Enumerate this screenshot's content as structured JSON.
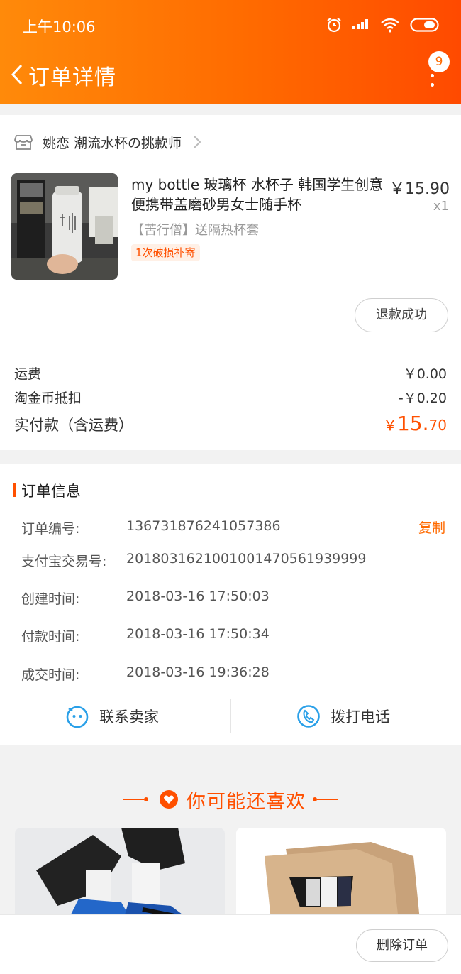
{
  "status_bar": {
    "time": "上午10:06"
  },
  "header": {
    "title": "订单详情",
    "message_count": "9"
  },
  "shop": {
    "name": "姚恋 潮流水杯の挑款师"
  },
  "product": {
    "title": "my bottle 玻璃杯 水杯子 韩国学生创意便携带盖磨砂男女士随手杯",
    "price": "￥15.90",
    "quantity": "x1",
    "sku": "【苦行僧】送隔热杯套",
    "tag": "1次破损补寄",
    "refund_status": "退款成功"
  },
  "fees": {
    "shipping_label": "运费",
    "shipping_value": "￥0.00",
    "coin_label": "淘金币抵扣",
    "coin_value": "-￥0.20",
    "total_label": "实付款（含运费）",
    "total_currency": "￥",
    "total_int": "15.",
    "total_dec": "70"
  },
  "order_info": {
    "title": "订单信息",
    "copy_label": "复制",
    "rows": [
      {
        "label": "订单编号:",
        "value": "136731876241057386"
      },
      {
        "label": "支付宝交易号:",
        "value": "2018031621001001470561939999"
      },
      {
        "label": "创建时间:",
        "value": "2018-03-16 17:50:03"
      },
      {
        "label": "付款时间:",
        "value": "2018-03-16 17:50:34"
      },
      {
        "label": "成交时间:",
        "value": "2018-03-16 19:36:28"
      }
    ]
  },
  "contact": {
    "seller_label": "联系卖家",
    "phone_label": "拨打电话"
  },
  "recommend": {
    "title": "你可能还喜欢"
  },
  "bottom": {
    "delete_label": "删除订单"
  },
  "colors": {
    "accent": "#ff5000",
    "header_start": "#ff8a0a",
    "header_end": "#ff4a00"
  }
}
